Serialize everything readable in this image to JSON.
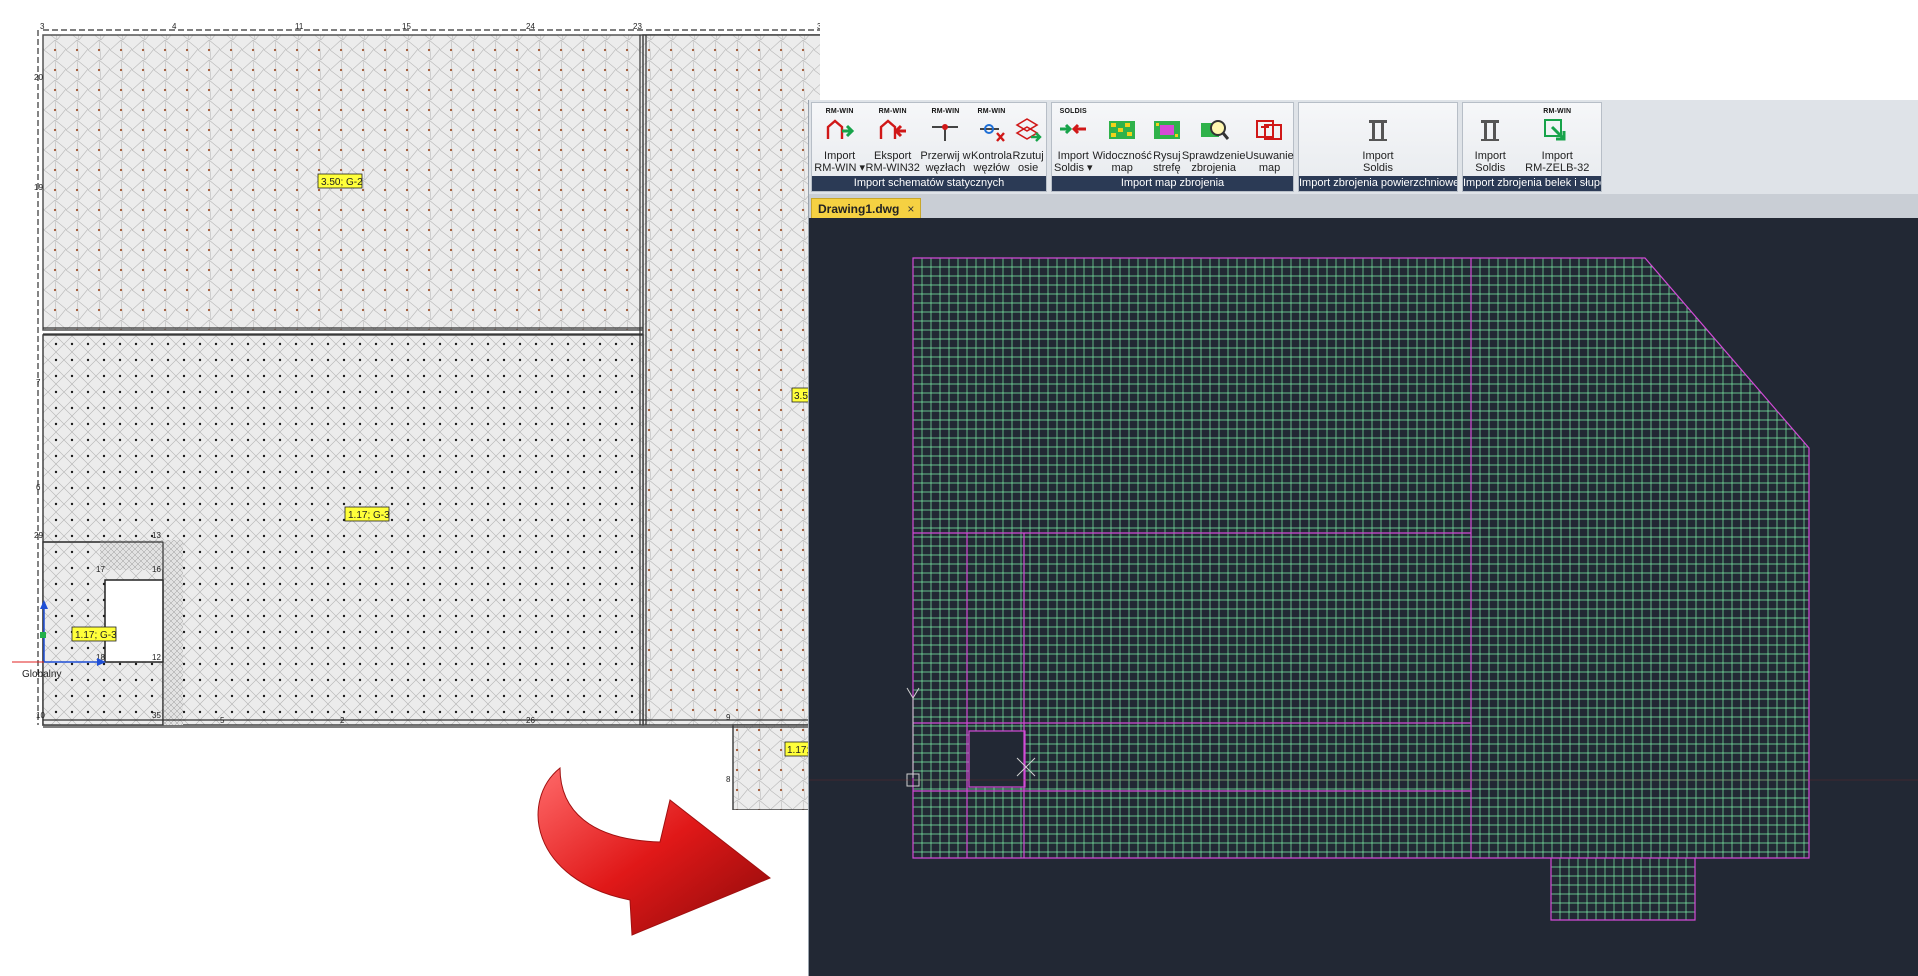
{
  "fem_model": {
    "panel_labels": [
      {
        "text": "3.50; G-2"
      },
      {
        "text": "1.17; G-3"
      },
      {
        "text": "1.17; G-3"
      },
      {
        "text": "3.5"
      },
      {
        "text": "1.17;"
      }
    ],
    "coordinate_label": "Globalny",
    "node_numbers": [
      "3",
      "4",
      "11",
      "15",
      "24",
      "23",
      "33",
      "20",
      "19",
      "7",
      "6",
      "29",
      "13",
      "17",
      "16",
      "18",
      "12",
      "10",
      "35",
      "5",
      "2",
      "26",
      "8",
      "9"
    ]
  },
  "ribbon": {
    "groups": [
      {
        "label": "Import schematów statycznych",
        "tools": [
          {
            "brand": "RM-WIN",
            "label": "Import\nRM-WIN",
            "icon": "import-rmwin-icon",
            "dropdown": true
          },
          {
            "brand": "RM-WIN",
            "label": "Eksport\nRM-WIN32",
            "icon": "export-rmwin-icon"
          },
          {
            "brand": "RM-WIN",
            "label": "Przerwij w\nwęzłach",
            "icon": "break-nodes-icon"
          },
          {
            "brand": "RM-WIN",
            "label": "Kontrola\nwęzłów",
            "icon": "node-control-icon"
          },
          {
            "brand": "",
            "label": "Rzutuj\nosie",
            "icon": "project-axes-icon"
          }
        ]
      },
      {
        "label": "Import map zbrojenia",
        "tools": [
          {
            "brand": "SOLDIS",
            "label": "Import\nSoldis",
            "icon": "import-soldis-icon",
            "dropdown": true
          },
          {
            "brand": "",
            "label": "Widoczność\nmap",
            "icon": "map-visibility-icon"
          },
          {
            "brand": "",
            "label": "Rysuj\nstrefę",
            "icon": "draw-zone-icon"
          },
          {
            "brand": "",
            "label": "Sprawdzenie\nzbrojenia",
            "icon": "check-reinforcement-icon"
          },
          {
            "brand": "",
            "label": "Usuwanie\nmap",
            "icon": "remove-maps-icon"
          }
        ]
      },
      {
        "label": "Import zbrojenia powierzchniowego",
        "tools": [
          {
            "brand": "",
            "label": "Import\nSoldis",
            "icon": "import-soldis-surface-icon"
          }
        ]
      },
      {
        "label": "Import zbrojenia belek i słupów",
        "tools": [
          {
            "brand": "",
            "label": "Import\nSoldis",
            "icon": "import-soldis-beams-icon"
          },
          {
            "brand": "RM-WIN",
            "label": "Import\nRM-ZELB-32",
            "icon": "import-rmzelb-icon"
          }
        ]
      }
    ]
  },
  "file_tab": {
    "name": "Drawing1.dwg",
    "close": "×"
  },
  "colors": {
    "cad_background": "#222834",
    "cad_grid": "#7ff0a8",
    "cad_outline": "#d24ad6",
    "ribbon_label_bg": "#2b3a55",
    "tab_active": "#f5d142",
    "fem_background": "#ebebeb",
    "fem_label": "#ffff3a",
    "arrow": "#e01818"
  }
}
